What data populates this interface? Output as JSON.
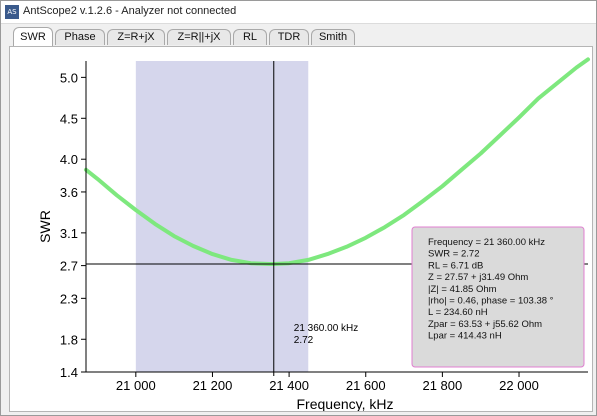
{
  "window": {
    "title": "AntScope2 v.1.2.6 - Analyzer not connected",
    "icon_text": "AS",
    "icon": "app-icon"
  },
  "tabs": [
    {
      "label": "SWR",
      "active": true
    },
    {
      "label": "Phase",
      "active": false
    },
    {
      "label": "Z=R+jX",
      "active": false
    },
    {
      "label": "Z=R||+jX",
      "active": false
    },
    {
      "label": "RL",
      "active": false
    },
    {
      "label": "TDR",
      "active": false
    },
    {
      "label": "Smith",
      "active": false
    }
  ],
  "colors": {
    "curve": "#7ee87e",
    "band": "#d5d6ec",
    "info_bg": "#dadada",
    "info_border": "#e07fd0",
    "axis": "#000000"
  },
  "chart_data": {
    "type": "line",
    "xlabel": "Frequency, kHz",
    "ylabel": "SWR",
    "xlim": [
      20870,
      22180
    ],
    "ylim": [
      1.4,
      5.2
    ],
    "x_ticks": [
      21000,
      21200,
      21400,
      21600,
      21800,
      22000
    ],
    "x_tick_labels": [
      "21 000",
      "21 200",
      "21 400",
      "21 600",
      "21 800",
      "22 000"
    ],
    "y_ticks": [
      1.4,
      1.8,
      2.3,
      2.7,
      3.1,
      3.6,
      4.0,
      4.5,
      5.0
    ],
    "y_tick_labels": [
      "1.4",
      "1.8",
      "2.3",
      "2.7",
      "3.1",
      "3.6",
      "4.0",
      "4.5",
      "5.0"
    ],
    "series": [
      {
        "x": [
          20870,
          20900,
          20950,
          21000,
          21050,
          21100,
          21150,
          21200,
          21250,
          21300,
          21350,
          21360,
          21400,
          21450,
          21500,
          21550,
          21600,
          21650,
          21700,
          21750,
          21800,
          21850,
          21900,
          21950,
          22000,
          22050,
          22100,
          22150,
          22180
        ],
        "values": [
          3.87,
          3.76,
          3.56,
          3.38,
          3.21,
          3.06,
          2.94,
          2.84,
          2.77,
          2.73,
          2.72,
          2.72,
          2.73,
          2.77,
          2.84,
          2.93,
          3.04,
          3.17,
          3.32,
          3.49,
          3.67,
          3.87,
          4.07,
          4.29,
          4.51,
          4.74,
          4.93,
          5.12,
          5.22
        ]
      }
    ],
    "highlight_band": [
      21000,
      21450
    ],
    "cursor": {
      "x": 21360,
      "y": 2.72
    },
    "cursor_label_freq": "21 360.00 kHz",
    "cursor_label_swr": "2.72",
    "info_lines": [
      "Frequency = 21 360.00 kHz",
      "SWR = 2.72",
      "RL = 6.71 dB",
      "Z = 27.57 + j31.49 Ohm",
      "|Z| = 41.85 Ohm",
      "|rho| = 0.46, phase = 103.38 °",
      "L = 234.60 nH",
      "Zpar = 63.53 + j55.62 Ohm",
      "Lpar = 414.43 nH"
    ]
  }
}
